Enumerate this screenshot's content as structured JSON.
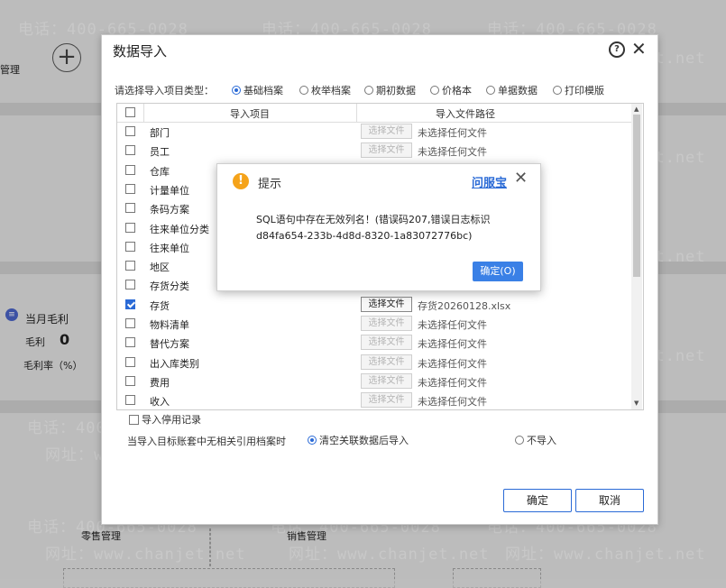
{
  "background": {
    "left_label_top": "管理",
    "monthly_gross_profit": "当月毛利",
    "gross_profit_label": "毛利",
    "gross_profit_value": "0",
    "gross_margin_label": "毛利率（%）",
    "retail_mgmt": "零售管理",
    "sales_mgmt": "销售管理",
    "watermark_phone": "电话：400-665-0028",
    "watermark_site": "网址：www.chanjet.net"
  },
  "dialog": {
    "title": "数据导入",
    "type_label": "请选择导入项目类型：",
    "types": [
      {
        "label": "基础档案",
        "selected": true
      },
      {
        "label": "枚举档案",
        "selected": false
      },
      {
        "label": "期初数据",
        "selected": false
      },
      {
        "label": "价格本",
        "selected": false
      },
      {
        "label": "单据数据",
        "selected": false
      },
      {
        "label": "打印模版",
        "selected": false
      }
    ],
    "headers": {
      "item": "导入项目",
      "path": "导入文件路径"
    },
    "rows": [
      {
        "name": "部门",
        "checked": false,
        "button": "选择文件",
        "path": "未选择任何文件",
        "active": false
      },
      {
        "name": "员工",
        "checked": false,
        "button": "选择文件",
        "path": "未选择任何文件",
        "active": false
      },
      {
        "name": "仓库",
        "checked": false,
        "button": "",
        "path": "",
        "active": false
      },
      {
        "name": "计量单位",
        "checked": false,
        "button": "",
        "path": "",
        "active": false
      },
      {
        "name": "条码方案",
        "checked": false,
        "button": "",
        "path": "",
        "active": false
      },
      {
        "name": "往来单位分类",
        "checked": false,
        "button": "",
        "path": "",
        "active": false
      },
      {
        "name": "往来单位",
        "checked": false,
        "button": "",
        "path": "",
        "active": false
      },
      {
        "name": "地区",
        "checked": false,
        "button": "",
        "path": "",
        "active": false
      },
      {
        "name": "存货分类",
        "checked": false,
        "button": "",
        "path": "",
        "active": false
      },
      {
        "name": "存货",
        "checked": true,
        "button": "选择文件",
        "path": "存货20260128.xlsx",
        "active": true
      },
      {
        "name": "物料清单",
        "checked": false,
        "button": "选择文件",
        "path": "未选择任何文件",
        "active": false
      },
      {
        "name": "替代方案",
        "checked": false,
        "button": "选择文件",
        "path": "未选择任何文件",
        "active": false
      },
      {
        "name": "出入库类别",
        "checked": false,
        "button": "选择文件",
        "path": "未选择任何文件",
        "active": false
      },
      {
        "name": "费用",
        "checked": false,
        "button": "选择文件",
        "path": "未选择任何文件",
        "active": false
      },
      {
        "name": "收入",
        "checked": false,
        "button": "选择文件",
        "path": "未选择任何文件",
        "active": false
      }
    ],
    "import_disabled_label": "导入停用记录",
    "ref_label": "当导入目标账套中无相关引用档案时",
    "ref_option_clear": "清空关联数据后导入",
    "ref_option_skip": "不导入",
    "confirm_label": "确定",
    "cancel_label": "取消"
  },
  "popup": {
    "title": "提示",
    "service_link": "问服宝",
    "message_line1": "SQL语句中存在无效列名！(错误码207,错误日志标识",
    "message_line2": "d84fa654-233b-4d8d-8320-1a83072776bc)",
    "ok_label": "确定(O)"
  },
  "colors": {
    "accent": "#2a6ad6",
    "ok_button": "#3a80e6",
    "warning": "#f5a31a"
  }
}
